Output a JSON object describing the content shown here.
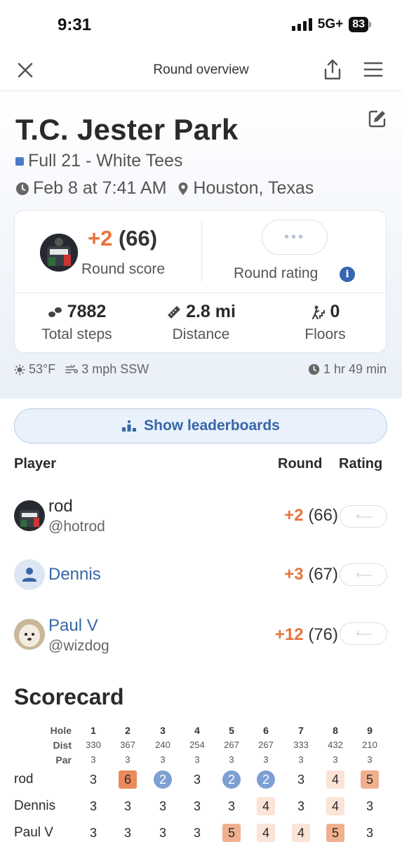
{
  "status_bar": {
    "time": "9:31",
    "network": "5G+",
    "battery": "83"
  },
  "nav": {
    "title": "Round overview"
  },
  "course": {
    "name": "T.C. Jester Park",
    "tees": "Full 21 - White Tees",
    "tee_color": "#4a7bc8",
    "date": "Feb 8 at 7:41 AM",
    "location": "Houston, Texas"
  },
  "summary": {
    "score_over": "+2",
    "score_total": "(66)",
    "score_label": "Round score",
    "rating_placeholder": "•••",
    "rating_label": "Round rating",
    "steps_value": "7882",
    "steps_label": "Total steps",
    "distance_value": "2.8 mi",
    "distance_label": "Distance",
    "floors_value": "0",
    "floors_label": "Floors"
  },
  "weather": {
    "temp": "53°F",
    "wind": "3 mph SSW",
    "duration": "1 hr 49 min"
  },
  "leaderboard_button": "Show leaderboards",
  "players_header": {
    "player": "Player",
    "round": "Round",
    "rating": "Rating"
  },
  "players": [
    {
      "name": "rod",
      "handle": "@hotrod",
      "over": "+2",
      "total": "(66)"
    },
    {
      "name": "Dennis",
      "handle": "",
      "over": "+3",
      "total": "(67)"
    },
    {
      "name": "Paul V",
      "handle": "@wizdog",
      "over": "+12",
      "total": "(76)"
    }
  ],
  "rating_pill": "+—",
  "scorecard": {
    "title": "Scorecard",
    "row_labels": {
      "hole": "Hole",
      "dist": "Dist",
      "par": "Par"
    },
    "holes": [
      "1",
      "2",
      "3",
      "4",
      "5",
      "6",
      "7",
      "8",
      "9"
    ],
    "dist": [
      "330",
      "367",
      "240",
      "254",
      "267",
      "267",
      "333",
      "432",
      "210"
    ],
    "par": [
      "3",
      "3",
      "3",
      "3",
      "3",
      "3",
      "3",
      "3",
      "3"
    ],
    "scores": [
      {
        "player": "rod",
        "values": [
          "3",
          "6",
          "2",
          "3",
          "2",
          "2",
          "3",
          "4",
          "5"
        ]
      },
      {
        "player": "Dennis",
        "values": [
          "3",
          "3",
          "3",
          "3",
          "3",
          "4",
          "3",
          "4",
          "3"
        ]
      },
      {
        "player": "Paul V",
        "values": [
          "3",
          "3",
          "3",
          "3",
          "5",
          "4",
          "4",
          "5",
          "3"
        ]
      }
    ]
  }
}
